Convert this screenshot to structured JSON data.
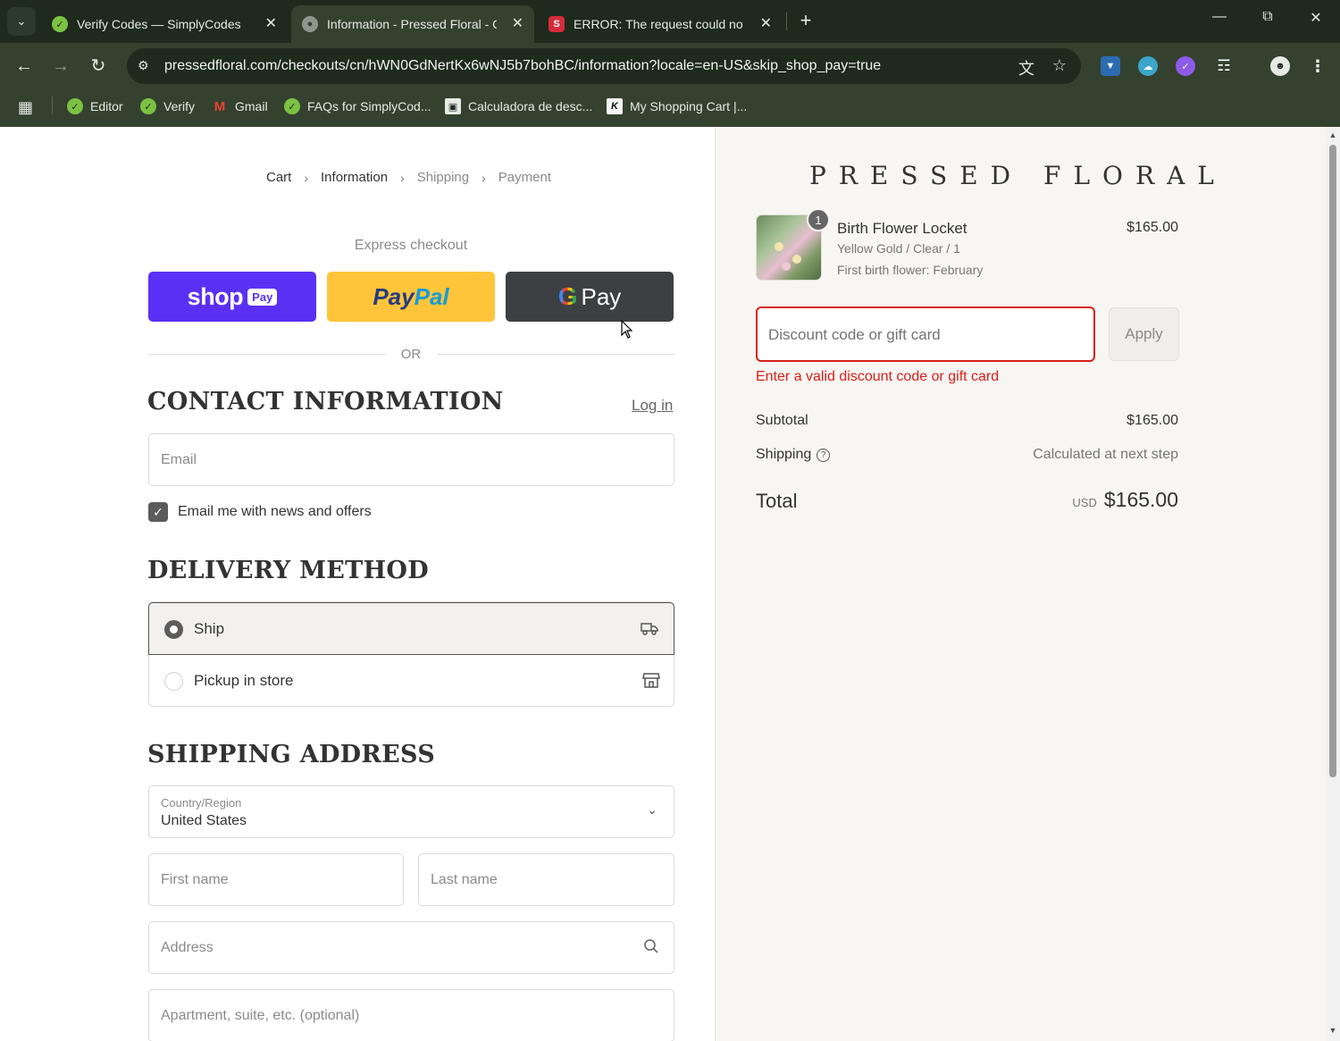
{
  "browser": {
    "tabs": [
      {
        "title": "Verify Codes — SimplyCodes",
        "active": false
      },
      {
        "title": "Information - Pressed Floral - C",
        "active": true
      },
      {
        "title": "ERROR: The request could not b",
        "active": false
      }
    ],
    "url": "pressedfloral.com/checkouts/cn/hWN0GdNertKx6wNJ5b7bohBC/information?locale=en-US&skip_shop_pay=true",
    "bookmarks": [
      {
        "label": "Editor"
      },
      {
        "label": "Verify"
      },
      {
        "label": "Gmail"
      },
      {
        "label": "FAQs for SimplyCod..."
      },
      {
        "label": "Calculadora de desc..."
      },
      {
        "label": "My Shopping Cart |..."
      }
    ]
  },
  "breadcrumb": {
    "items": [
      "Cart",
      "Information",
      "Shipping",
      "Payment"
    ]
  },
  "express": {
    "label": "Express checkout",
    "shop_pay": {
      "word": "shop",
      "badge": "Pay"
    },
    "paypal": {
      "part1": "Pay",
      "part2": "Pal"
    },
    "gpay": {
      "g": "G",
      "word": "Pay"
    },
    "or": "OR"
  },
  "contact": {
    "heading": "CONTACT INFORMATION",
    "login": "Log in",
    "email_placeholder": "Email",
    "newsletter_label": "Email me with news and offers",
    "newsletter_checked": true
  },
  "delivery": {
    "heading": "DELIVERY METHOD",
    "options": [
      {
        "label": "Ship",
        "selected": true
      },
      {
        "label": "Pickup in store",
        "selected": false
      }
    ]
  },
  "shipping": {
    "heading": "SHIPPING ADDRESS",
    "country_label": "Country/Region",
    "country_value": "United States",
    "first_name_placeholder": "First name",
    "last_name_placeholder": "Last name",
    "address_placeholder": "Address",
    "apartment_placeholder": "Apartment, suite, etc. (optional)"
  },
  "summary": {
    "brand": "PRESSED FLORAL",
    "item": {
      "quantity": "1",
      "name": "Birth Flower Locket",
      "variant": "Yellow Gold / Clear / 1",
      "option": "First birth flower: February",
      "price": "$165.00"
    },
    "discount_placeholder": "Discount code or gift card",
    "apply_label": "Apply",
    "error": "Enter a valid discount code or gift card",
    "subtotal_label": "Subtotal",
    "subtotal_value": "$165.00",
    "shipping_label": "Shipping",
    "shipping_value": "Calculated at next step",
    "total_label": "Total",
    "currency": "USD",
    "total_value": "$165.00"
  },
  "colors": {
    "shop_pay": "#5a31f4",
    "paypal": "#ffc439",
    "gpay": "#3c4043",
    "error": "#d91e18",
    "chrome": "#1d2a1c"
  }
}
